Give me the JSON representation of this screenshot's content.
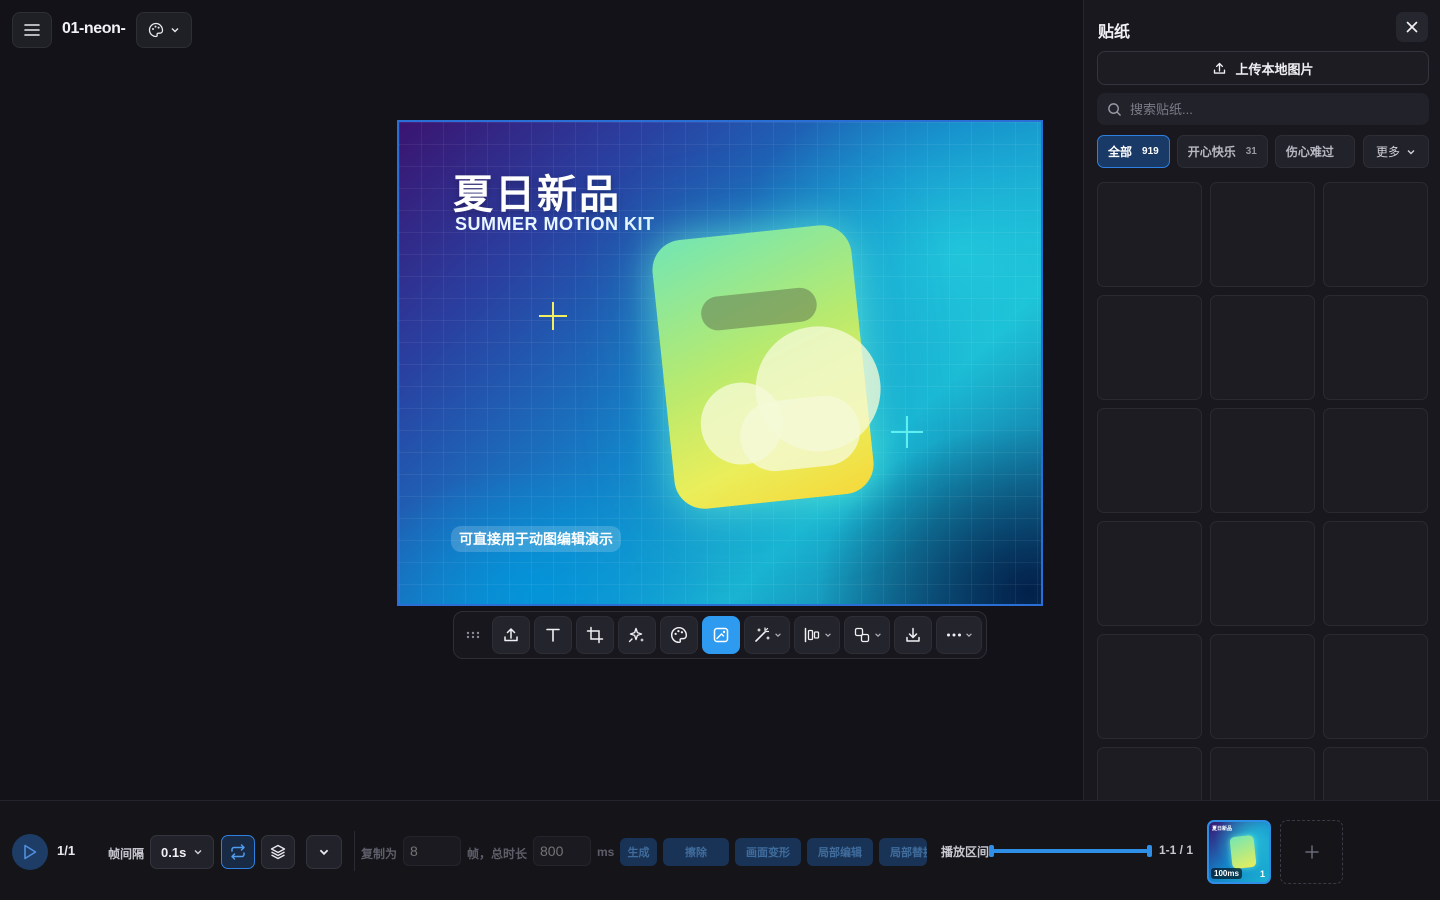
{
  "header": {
    "doc_title": "01-neon-",
    "icons": {
      "menu": "hamburger-menu-icon",
      "theme": "palette-icon"
    }
  },
  "canvas": {
    "title": "夏日新品",
    "subtitle": "SUMMER MOTION KIT",
    "tag": "可直接用于动图编辑演示",
    "colors": {
      "frame_border": "#2a6fd6",
      "card_top": "#72e6b4",
      "card_bottom": "#f6d83a",
      "plus_yellow": "#f2f060",
      "plus_cyan": "#5ef0f0"
    }
  },
  "toolbar": {
    "tools": [
      "drag-handle",
      "upload",
      "text",
      "crop",
      "magic-sparkle",
      "palette",
      "image-edit",
      "magic-wand",
      "align",
      "transform",
      "download",
      "more"
    ],
    "active_tool": "image-edit",
    "accent": "#2f9bf0"
  },
  "panel": {
    "title": "贴纸",
    "upload_label": "上传本地图片",
    "search_placeholder": "搜索贴纸...",
    "categories": [
      {
        "label": "全部",
        "count": "919",
        "active": true
      },
      {
        "label": "开心快乐",
        "count": "31",
        "active": false
      },
      {
        "label": "伤心难过",
        "count": "",
        "active": false
      }
    ],
    "more_label": "更多",
    "grid_cells": 18
  },
  "bottom": {
    "frame_counter": "1/1",
    "interval_label": "帧间隔",
    "interval_value": "0.1s",
    "copy_label": "复制为",
    "copy_placeholder": "8",
    "frames_total_label": "帧，总时长",
    "duration_placeholder": "800",
    "ms_label": "ms",
    "actions": [
      "生成",
      "擦除",
      "画面变形",
      "局部编辑",
      "局部替换"
    ],
    "range_label": "播放区间",
    "range_text": "1-1 / 1",
    "thumbnail": {
      "title": "夏日新品",
      "duration": "100ms",
      "index": "1"
    }
  }
}
